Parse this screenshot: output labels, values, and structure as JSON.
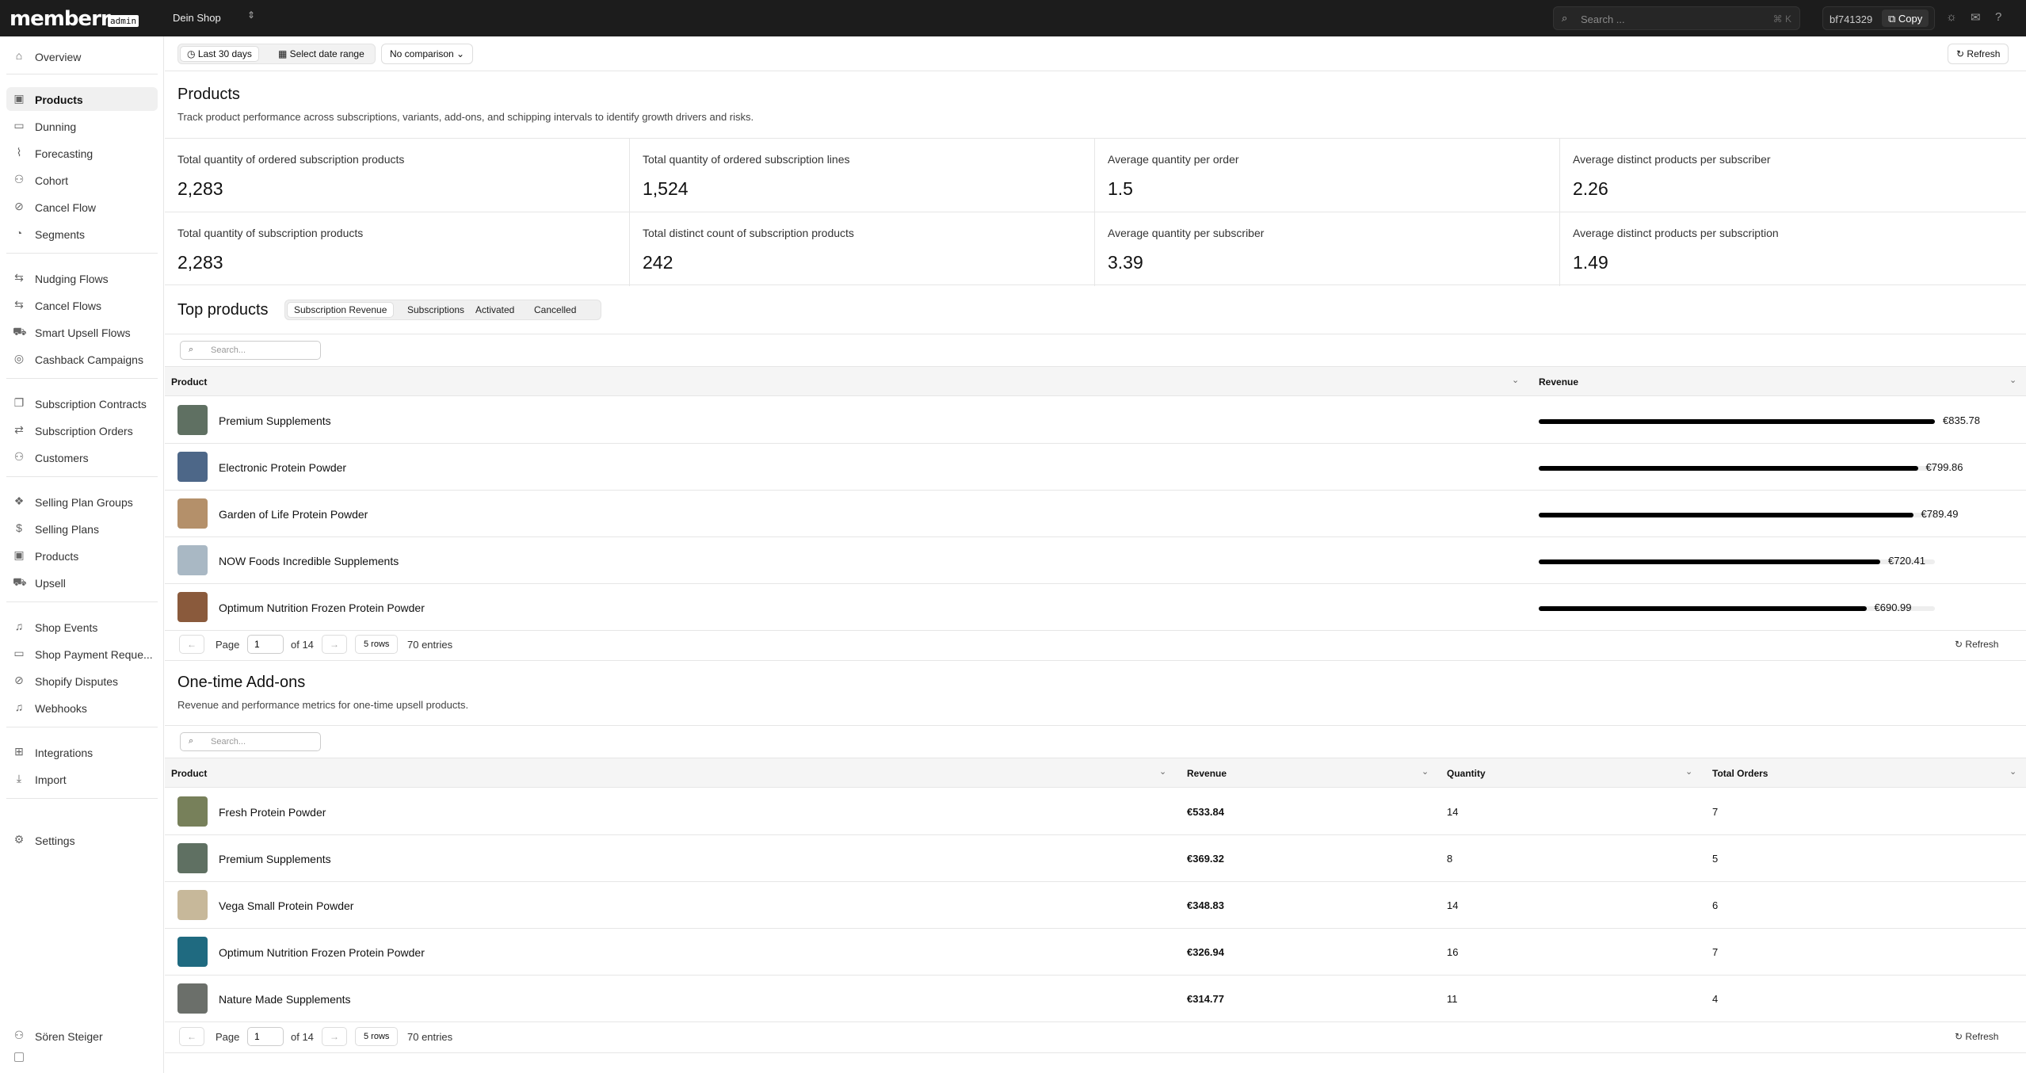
{
  "topbar": {
    "logo": "memberr",
    "logo_badge": "admin",
    "shop_name": "Dein Shop",
    "search_placeholder": "Search ...",
    "search_shortcut": "⌘ K",
    "shop_id": "bf741329",
    "copy_label": "Copy"
  },
  "sidebar": {
    "items": [
      {
        "label": "Overview",
        "icon": "home-icon"
      },
      {
        "label": "Products",
        "icon": "box-icon",
        "active": true
      },
      {
        "label": "Dunning",
        "icon": "card-icon"
      },
      {
        "label": "Forecasting",
        "icon": "chart-line-icon"
      },
      {
        "label": "Cohort",
        "icon": "users-icon"
      },
      {
        "label": "Cancel Flow",
        "icon": "ban-icon"
      },
      {
        "label": "Segments",
        "icon": "pie-icon"
      },
      {
        "label": "Nudging Flows",
        "icon": "flow-icon"
      },
      {
        "label": "Cancel Flows",
        "icon": "flow-icon"
      },
      {
        "label": "Smart Upsell Flows",
        "icon": "cart-icon"
      },
      {
        "label": "Cashback Campaigns",
        "icon": "coins-icon"
      },
      {
        "label": "Subscription Contracts",
        "icon": "files-icon"
      },
      {
        "label": "Subscription Orders",
        "icon": "arrows-icon"
      },
      {
        "label": "Customers",
        "icon": "users-icon"
      },
      {
        "label": "Selling Plan Groups",
        "icon": "layers-icon"
      },
      {
        "label": "Selling Plans",
        "icon": "dollar-icon"
      },
      {
        "label": "Products",
        "icon": "box-icon"
      },
      {
        "label": "Upsell",
        "icon": "cart-icon"
      },
      {
        "label": "Shop Events",
        "icon": "bell-icon"
      },
      {
        "label": "Shop Payment Reque...",
        "icon": "card-icon"
      },
      {
        "label": "Shopify Disputes",
        "icon": "ban-icon"
      },
      {
        "label": "Webhooks",
        "icon": "bell-icon"
      },
      {
        "label": "Integrations",
        "icon": "grid-icon"
      },
      {
        "label": "Import",
        "icon": "import-icon"
      },
      {
        "label": "Settings",
        "icon": "gear-icon"
      }
    ],
    "user_name": "Sören Steiger"
  },
  "filters": {
    "last_30": "Last 30 days",
    "date_range": "Select date range",
    "comparison": "No comparison",
    "refresh": "Refresh"
  },
  "products": {
    "title": "Products",
    "description": "Track product performance across subscriptions, variants, add-ons, and schipping intervals to identify growth drivers and risks.",
    "stats": [
      {
        "label": "Total quantity of ordered subscription products",
        "value": "2,283"
      },
      {
        "label": "Total quantity of ordered subscription lines",
        "value": "1,524"
      },
      {
        "label": "Average quantity per order",
        "value": "1.5"
      },
      {
        "label": "Average distinct products per subscriber",
        "value": "2.26"
      },
      {
        "label": "Total quantity of subscription products",
        "value": "2,283"
      },
      {
        "label": "Total distinct count of subscription products",
        "value": "242"
      },
      {
        "label": "Average quantity per subscriber",
        "value": "3.39"
      },
      {
        "label": "Average distinct products per subscription",
        "value": "1.49"
      }
    ]
  },
  "top_products": {
    "title": "Top products",
    "tabs": [
      "Subscription Revenue",
      "Subscriptions",
      "Activated",
      "Cancelled"
    ],
    "search_placeholder": "Search...",
    "col_product": "Product",
    "col_revenue": "Revenue",
    "rows": [
      {
        "name": "Premium Supplements",
        "revenue": "€835.78",
        "fraction": 1.0,
        "thumb": "#5f7062"
      },
      {
        "name": "Electronic Protein Powder",
        "revenue": "€799.86",
        "fraction": 0.957,
        "thumb": "#4d6788"
      },
      {
        "name": "Garden of Life Protein Powder",
        "revenue": "€789.49",
        "fraction": 0.945,
        "thumb": "#b4906a"
      },
      {
        "name": "NOW Foods Incredible Supplements",
        "revenue": "€720.41",
        "fraction": 0.862,
        "thumb": "#a9b8c4"
      },
      {
        "name": "Optimum Nutrition Frozen Protein Powder",
        "revenue": "€690.99",
        "fraction": 0.827,
        "thumb": "#8a5a3c"
      }
    ],
    "pager": {
      "page_label": "Page",
      "page": "1",
      "of": "of 14",
      "rows": "5 rows",
      "entries": "70 entries",
      "refresh": "Refresh"
    }
  },
  "addons": {
    "title": "One-time Add-ons",
    "description": "Revenue and performance metrics for one-time upsell products.",
    "search_placeholder": "Search...",
    "cols": [
      "Product",
      "Revenue",
      "Quantity",
      "Total Orders"
    ],
    "rows": [
      {
        "name": "Fresh Protein Powder",
        "revenue": "€533.84",
        "qty": "14",
        "orders": "7",
        "thumb": "#77805a"
      },
      {
        "name": "Premium Supplements",
        "revenue": "€369.32",
        "qty": "8",
        "orders": "5",
        "thumb": "#5f7062"
      },
      {
        "name": "Vega Small Protein Powder",
        "revenue": "€348.83",
        "qty": "14",
        "orders": "6",
        "thumb": "#c7b89a"
      },
      {
        "name": "Optimum Nutrition Frozen Protein Powder",
        "revenue": "€326.94",
        "qty": "16",
        "orders": "7",
        "thumb": "#1f6a80"
      },
      {
        "name": "Nature Made Supplements",
        "revenue": "€314.77",
        "qty": "11",
        "orders": "4",
        "thumb": "#6b6f6a"
      }
    ],
    "pager": {
      "page_label": "Page",
      "page": "1",
      "of": "of 14",
      "rows": "5 rows",
      "entries": "70 entries",
      "refresh": "Refresh"
    }
  }
}
